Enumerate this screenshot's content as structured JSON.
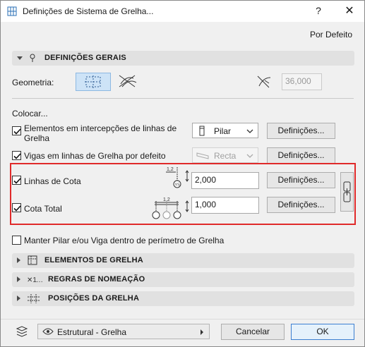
{
  "window": {
    "title": "Definições de Sistema de Grelha...",
    "help": "?",
    "close": "✕"
  },
  "header": {
    "default_link": "Por Defeito"
  },
  "sections": {
    "general": "DEFINIÇÕES GERAIS",
    "grid_elements": "ELEMENTOS DE GRELHA",
    "naming_rules": "REGRAS DE NOMEAÇÃO",
    "grid_positions": "POSIÇÕES DA GRELHA"
  },
  "geometry": {
    "label": "Geometria:",
    "angle_value": "36,000"
  },
  "place": {
    "label": "Colocar...",
    "rows": [
      {
        "label": "Elementos em intercepções de linhas de Grelha",
        "checked": true,
        "combo": "Pilar",
        "button": "Definições..."
      },
      {
        "label": "Vigas em linhas de Grelha por defeito",
        "checked": true,
        "combo": "Recta",
        "button": "Definições..."
      },
      {
        "label": "Linhas de Cota",
        "checked": true,
        "value": "2,000",
        "button": "Definições..."
      },
      {
        "label": "Cota Total",
        "checked": true,
        "value": "1,000",
        "button": "Definições..."
      }
    ],
    "dim_labels": {
      "small": "1,2",
      "total": "1,2",
      "marker": "YS"
    }
  },
  "keep_within": {
    "label": "Manter Pilar e/ou Viga dentro de perímetro de Grelha",
    "checked": false
  },
  "footer": {
    "layer": "Estrutural - Grelha",
    "cancel": "Cancelar",
    "ok": "OK"
  }
}
